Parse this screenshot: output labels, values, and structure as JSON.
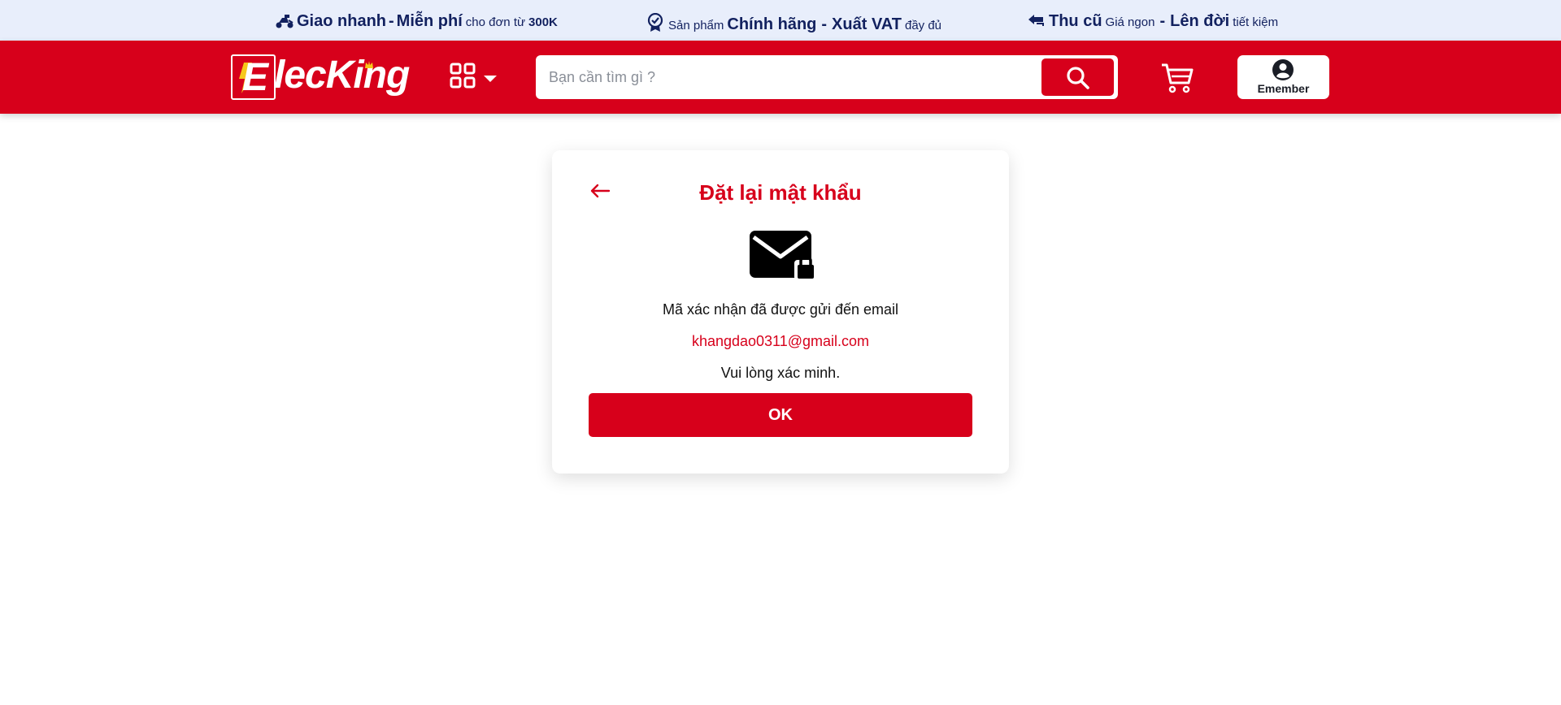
{
  "promo": {
    "item1": {
      "icon": "scooter-icon",
      "bold1": "Giao nhanh",
      "sep": "-",
      "bold2": "Miễn phí",
      "small": "cho đơn từ",
      "small_bold": "300K"
    },
    "item2": {
      "icon": "badge-check-icon",
      "small1": "Sản phẩm",
      "bold1": "Chính hãng",
      "sep": "-",
      "bold2": "Xuất VAT",
      "small2": "đầy đủ"
    },
    "item3": {
      "icon": "exchange-icon",
      "bold1": "Thu cũ",
      "small1": "Giá ngon",
      "sep": "-",
      "bold2": "Lên đời",
      "small2": "tiết kiệm"
    }
  },
  "header": {
    "logo_text": "lecKing",
    "logo_letter": "E",
    "search_placeholder": "Bạn cần tìm gì ?",
    "account_label": "Emember"
  },
  "dialog": {
    "title": "Đặt lại mật khẩu",
    "line1": "Mã xác nhận đã được gửi đến email",
    "email": "khangdao0311@gmail.com",
    "line2": "Vui lòng xác minh.",
    "ok_label": "OK"
  },
  "colors": {
    "brand_red": "#d7001b",
    "promo_bg": "#e8eefb",
    "promo_text": "#12215f"
  }
}
